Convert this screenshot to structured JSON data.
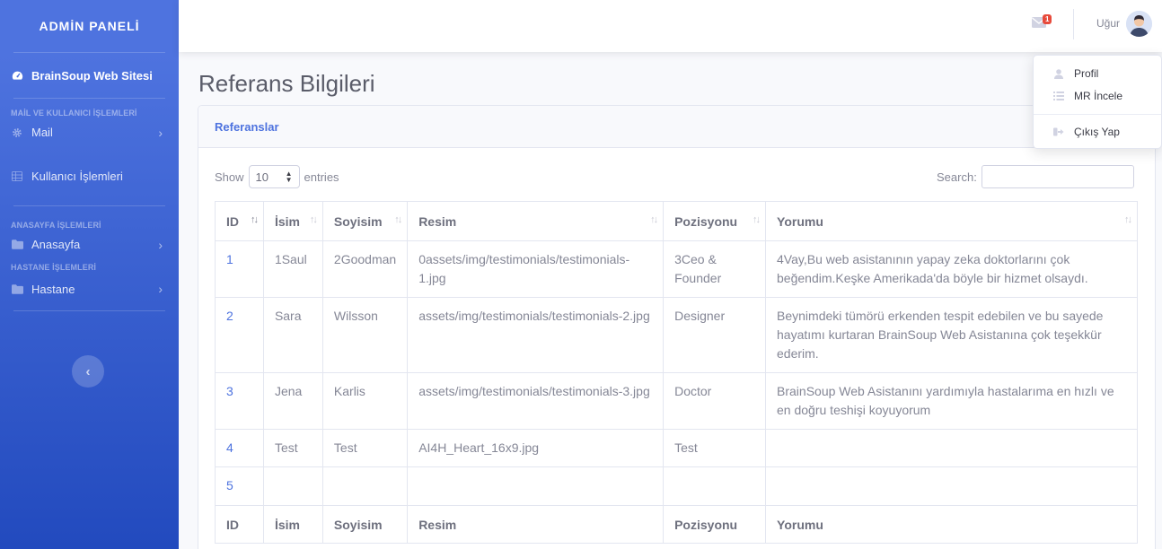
{
  "sidebar": {
    "brand": "ADMİN PANELİ",
    "site_link": "BrainSoup Web Sitesi",
    "sections": [
      {
        "heading": "MAİL VE KULLANICI İŞLEMLERİ"
      },
      {
        "heading": "ANASAYFA İŞLEMLERİ"
      },
      {
        "heading": "HASTANE İŞLEMLERİ"
      }
    ],
    "items": {
      "mail": "Mail",
      "users": "Kullanıcı İşlemleri",
      "home": "Anasayfa",
      "hospital": "Hastane"
    },
    "toggle_icon": "chevron-left-icon"
  },
  "topbar": {
    "mail_badge": "1",
    "user_name": "Uğur"
  },
  "dropdown": {
    "profile": "Profil",
    "mr_review": "MR İncele",
    "logout": "Çıkış Yap"
  },
  "page": {
    "title": "Referans Bilgileri",
    "card_title": "Referanslar",
    "show_label": "Show",
    "entries_value": "10",
    "entries_label": "entries",
    "search_label": "Search:"
  },
  "table": {
    "columns": [
      "ID",
      "İsim",
      "Soyisim",
      "Resim",
      "Pozisyonu",
      "Yorumu"
    ],
    "rows": [
      [
        "1",
        "1Saul",
        "2Goodman",
        "0assets/img/testimonials/testimonials-1.jpg",
        "3Ceo & Founder",
        "4Vay,Bu web asistanının yapay zeka doktorlarını çok beğendim.Keşke Amerikada'da böyle bir hizmet olsaydı."
      ],
      [
        "2",
        "Sara",
        "Wilsson",
        "assets/img/testimonials/testimonials-2.jpg",
        "Designer",
        "Beynimdeki tümörü erkenden tespit edebilen ve bu sayede hayatımı kurtaran BrainSoup Web Asistanına çok teşekkür ederim."
      ],
      [
        "3",
        "Jena",
        "Karlis",
        "assets/img/testimonials/testimonials-3.jpg",
        "Doctor",
        "BrainSoup Web Asistanını yardımıyla hastalarıma en hızlı ve en doğru teshişi koyuyorum"
      ],
      [
        "4",
        "Test",
        "Test",
        "AI4H_Heart_16x9.jpg",
        "Test",
        ""
      ],
      [
        "5",
        "",
        "",
        "",
        "",
        ""
      ]
    ]
  }
}
